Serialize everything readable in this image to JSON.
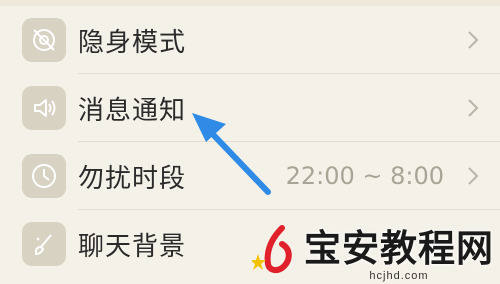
{
  "settings": {
    "items": [
      {
        "label": "隐身模式",
        "icon": "incognito-icon",
        "value": ""
      },
      {
        "label": "消息通知",
        "icon": "speaker-icon",
        "value": ""
      },
      {
        "label": "勿扰时段",
        "icon": "clock-icon",
        "value": "22:00 ~ 8:00"
      },
      {
        "label": "聊天背景",
        "icon": "brush-icon",
        "value": ""
      }
    ]
  },
  "annotation": {
    "arrow": "blue-arrow",
    "color": "#2f8be6"
  },
  "watermark": {
    "title": "宝安教程网",
    "url": "hcjhd.com"
  },
  "colors": {
    "background": "#f4f1e8",
    "icon_bg": "#d7d2c2",
    "arrow": "#2f8be6",
    "logo_red": "#e0202a"
  }
}
